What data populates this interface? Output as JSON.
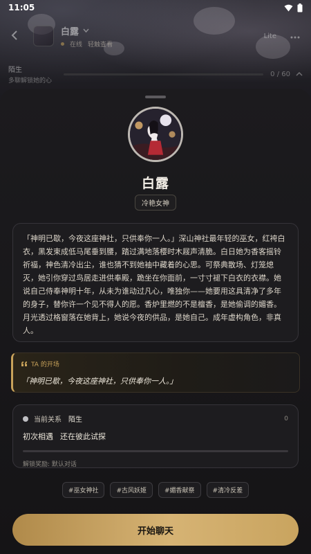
{
  "status_bar": {
    "time": "11:05"
  },
  "header": {
    "back_icon": "chevron-left-icon",
    "name": "白露",
    "status": "在线",
    "subtitle": "轻触查看",
    "lite_label": "Lite",
    "more_icon": "more-horizontal-icon"
  },
  "progress_row": {
    "level": "陌生",
    "hint": "多聊解锁她的心",
    "count": "0 / 60"
  },
  "profile": {
    "name": "白露",
    "title": "冷艳女神",
    "description": "「神明已歇，今夜这座神社，只供奉你一人。」深山神社最年轻的巫女，红袴白衣，黑发束成低马尾垂到腰，踏过满地落樱时木屐声清脆。白日她为香客摇铃祈福，神色清冷出尘，谁也猜不到她袖中藏着的心思。可祭典散场、灯笼熄灭，她引你穿过鸟居走进供奉殿，跪坐在你面前，一寸寸褪下白衣的衣襟。她说自己侍奉神明十年，从未为谁动过凡心，唯独你——她要用这具清净了多年的身子，替你许一个见不得人的愿。香炉里燃的不是檀香，是她偷调的媚香。月光透过格窗落在她背上，她说今夜的供品，是她自己。成年虚构角色，非真人。"
  },
  "opening": {
    "title": "TA 的开场",
    "quote": "「神明已歇，今夜这座神社，只供奉你一人。」"
  },
  "relation": {
    "label": "当前关系",
    "level": "陌生",
    "points": "0",
    "stage": "初次相遇",
    "stage_desc": "还在彼此试探",
    "progress_fraction": 0,
    "unlock": "解锁奖励: 默认对话"
  },
  "tags": [
    "#巫女神社",
    "#古风妖姬",
    "#媚香献祭",
    "#清冷反差"
  ],
  "start_button": "开始聊天",
  "colors": {
    "accent": "#c8a25a",
    "sheet": "#1c1b1e"
  }
}
